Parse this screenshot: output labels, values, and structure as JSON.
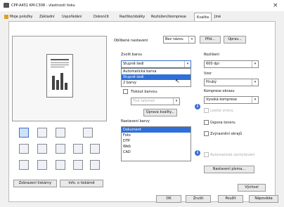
{
  "window": {
    "title": "CPP-A451 KM-C308 - vlastnosti tisku",
    "close_glyph": "×"
  },
  "tabs": [
    {
      "label": "Moje položky"
    },
    {
      "label": "Základní"
    },
    {
      "label": "Uspořádání"
    },
    {
      "label": "Dokončit"
    },
    {
      "label": "Razítko/obálky"
    },
    {
      "label": "Rozložení/komprese"
    },
    {
      "label": "Kvalita"
    },
    {
      "label": "Jiné"
    }
  ],
  "left": {
    "btn_view": "Zobrazení tiskárny",
    "btn_info": "Info. o tiskárně"
  },
  "favorites": {
    "label": "Oblíbené nastavení",
    "value": "Bez názvu",
    "add": "Přid...",
    "edit": "Úprav..."
  },
  "color": {
    "label": "Zvolit barvu",
    "value": "Stupně šedi",
    "options": [
      "Automatická barva",
      "Stupně šedi",
      "2 barvy"
    ],
    "selected_index": 1,
    "two_color_label": "Tiskout barvou:",
    "two_color_value": "Tisk talsmek",
    "edit_btn": "Úprava kvality..."
  },
  "color_settings": {
    "label": "Nastavení barvy",
    "items": [
      "Dokument",
      "Foto",
      "DTP",
      "Web",
      "CAD"
    ],
    "selected_index": 0
  },
  "resolution": {
    "label": "Rozlišení",
    "value": "600 dpi"
  },
  "pattern": {
    "label": "Vzor",
    "value": "Hrubý"
  },
  "compression": {
    "label": "Komprese obrazu",
    "value": "Vysoká komprese"
  },
  "checks": {
    "light_lines": "Lesklé vrstvy",
    "glossy": "Úspora toneru",
    "sharp": "Zvýraznění okrajů",
    "auto_trap": "Automatické zachytávání"
  },
  "font_btn": "Nastavení písma...",
  "default_btn": "Výchozí",
  "footer": {
    "ok": "OK",
    "cancel": "Zrušit",
    "apply": "Použít",
    "help": "Nápověda"
  }
}
